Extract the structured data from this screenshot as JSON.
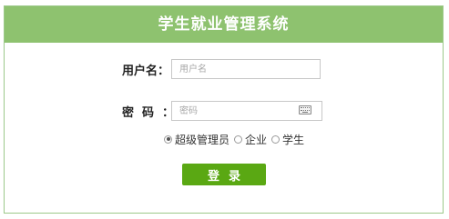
{
  "header": {
    "title": "学生就业管理系统"
  },
  "form": {
    "username": {
      "label": "用户名：",
      "placeholder": "用户名",
      "value": ""
    },
    "password": {
      "label": "密码：",
      "placeholder": "密码",
      "value": ""
    },
    "roles": [
      {
        "label": "超级管理员",
        "selected": true
      },
      {
        "label": "企业",
        "selected": false
      },
      {
        "label": "学生",
        "selected": false
      }
    ],
    "login_label": "登录"
  },
  "colors": {
    "header_bg": "#8ec26f",
    "border": "#9cc98a",
    "button_bg": "#5aa813"
  }
}
